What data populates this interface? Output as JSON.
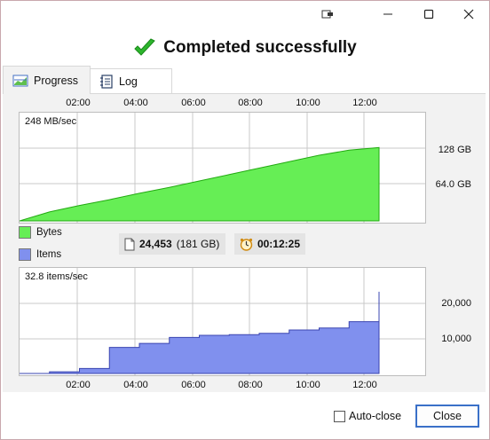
{
  "window": {
    "headline": "Completed successfully"
  },
  "tabs": [
    {
      "label": "Progress",
      "icon": "chart-icon",
      "active": true
    },
    {
      "label": "Log",
      "icon": "log-icon",
      "active": false
    }
  ],
  "progress": {
    "time_ticks": [
      "02:00",
      "04:00",
      "06:00",
      "08:00",
      "10:00",
      "12:00"
    ],
    "bytes_rate": "248 MB/sec",
    "bytes_ticks": [
      "128 GB",
      "64.0 GB"
    ],
    "items_rate": "32.8 items/sec",
    "items_ticks": [
      "20,000",
      "10,000"
    ],
    "legend": [
      {
        "label": "Bytes",
        "color": "#66ee55"
      },
      {
        "label": "Items",
        "color": "#8090ee"
      }
    ],
    "item_count": "24,453",
    "item_size": "(181 GB)",
    "elapsed": "00:12:25"
  },
  "footer": {
    "autoclose_label": "Auto-close",
    "autoclose_checked": false,
    "close_label": "Close"
  },
  "colors": {
    "bytes_fill": "#66ee55",
    "bytes_stroke": "#22aa11",
    "items_fill": "#8090ee",
    "items_stroke": "#3a44b0",
    "accent": "#3a70c8",
    "success": "#22aa22"
  },
  "chart_data": [
    {
      "type": "area",
      "series": [
        {
          "name": "Bytes",
          "values_gb": [
            0,
            14,
            24,
            33,
            43,
            52,
            62,
            72,
            82,
            92,
            102,
            110,
            114
          ]
        }
      ],
      "x": [
        "00:00",
        "01:00",
        "02:00",
        "03:00",
        "04:00",
        "05:00",
        "06:00",
        "07:00",
        "08:00",
        "09:00",
        "10:00",
        "11:00",
        "12:00"
      ],
      "ylim": [
        0,
        160
      ],
      "grid": true
    },
    {
      "type": "area",
      "series": [
        {
          "name": "Items",
          "values": [
            0,
            500,
            1500,
            7800,
            9000,
            10800,
            11400,
            11600,
            12000,
            13000,
            13600,
            15500,
            24453
          ]
        }
      ],
      "x": [
        "00:00",
        "01:00",
        "02:00",
        "03:00",
        "04:00",
        "05:00",
        "06:00",
        "07:00",
        "08:00",
        "09:00",
        "10:00",
        "11:00",
        "12:00"
      ],
      "ylim": [
        0,
        30000
      ],
      "grid": true
    }
  ]
}
